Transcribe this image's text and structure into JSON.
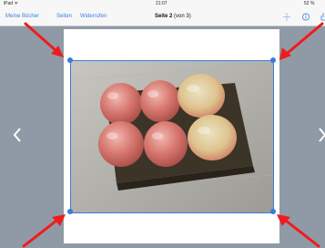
{
  "status_bar": {
    "carrier": "iPad ᯤ",
    "time": "21:07",
    "battery": "52 %"
  },
  "nav_bar": {
    "books_label": "Meine Bücher",
    "pages_label": "Seiten",
    "undo_label": "Widerrufen",
    "title_prefix": "Seite 2",
    "title_suffix": "(von 3)",
    "icons": [
      "plus-icon",
      "info-icon",
      "share-icon"
    ]
  },
  "document": {
    "image_subject": "Sechs Äpfel in einer Schale",
    "handle_color": "#3b7cd9",
    "annotation_arrow_color": "#ee1c1c"
  }
}
